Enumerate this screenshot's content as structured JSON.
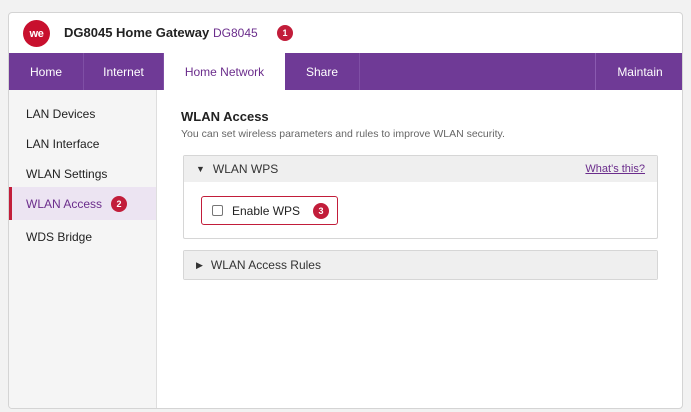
{
  "header": {
    "logo_text": "we",
    "title": "DG8045 Home Gateway",
    "model": "DG8045",
    "badge": "1"
  },
  "nav": {
    "tabs": [
      {
        "label": "Home"
      },
      {
        "label": "Internet"
      },
      {
        "label": "Home Network"
      },
      {
        "label": "Share"
      },
      {
        "label": "Maintain"
      }
    ],
    "active": "Home Network"
  },
  "sidebar": {
    "items": [
      {
        "label": "LAN Devices"
      },
      {
        "label": "LAN Interface"
      },
      {
        "label": "WLAN Settings"
      },
      {
        "label": "WLAN Access",
        "badge": "2"
      },
      {
        "label": "WDS Bridge"
      }
    ],
    "active": "WLAN Access"
  },
  "main": {
    "title": "WLAN Access",
    "subtitle": "You can set wireless parameters and rules to improve WLAN security.",
    "wps_panel": {
      "header": "WLAN WPS",
      "expanded": true,
      "help_link": "What's this?",
      "enable_label": "Enable WPS",
      "enable_checked": false,
      "badge": "3"
    },
    "rules_panel": {
      "header": "WLAN Access Rules",
      "expanded": false
    }
  },
  "colors": {
    "brand_red": "#c8102e",
    "nav_purple": "#6f3a96",
    "accent_purple": "#6b2d8c",
    "badge_red": "#c21d3a"
  },
  "icons": {
    "expanded": "triangle-down-icon",
    "collapsed": "triangle-right-icon"
  }
}
